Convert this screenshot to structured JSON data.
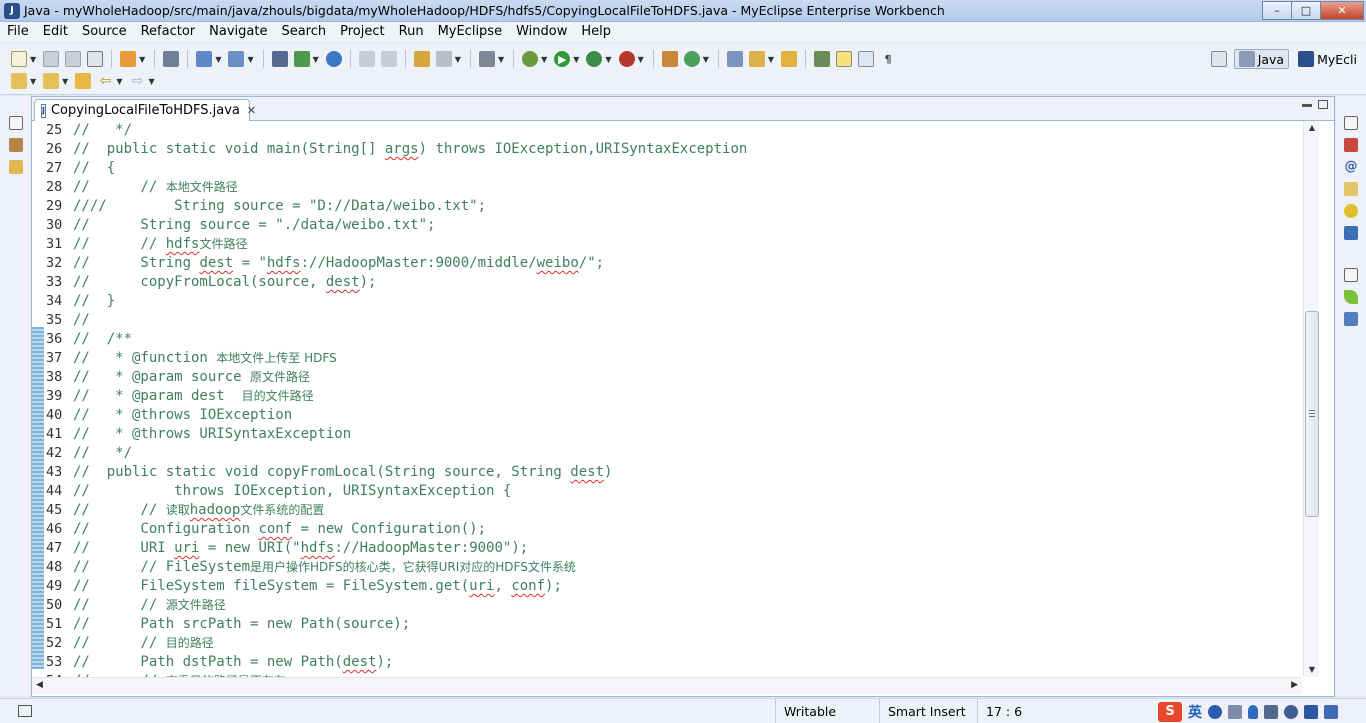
{
  "window": {
    "title": "Java - myWholeHadoop/src/main/java/zhouls/bigdata/myWholeHadoop/HDFS/hdfs5/CopyingLocalFileToHDFS.java - MyEclipse Enterprise Workbench",
    "app_icon": "J",
    "buttons": {
      "minimize": "–",
      "maximize": "□",
      "close": "✕"
    }
  },
  "menu": [
    "File",
    "Edit",
    "Source",
    "Refactor",
    "Navigate",
    "Search",
    "Project",
    "Run",
    "MyEclipse",
    "Window",
    "Help"
  ],
  "perspectives": {
    "java": "Java",
    "myeclipse": "MyEcli"
  },
  "editor": {
    "tab_label": "CopyingLocalFileToHDFS.java",
    "tab_icon": "J",
    "tab_close": "✕",
    "lines": [
      {
        "n": "25",
        "segs": [
          {
            "t": "//   */"
          }
        ]
      },
      {
        "n": "26",
        "segs": [
          {
            "t": "//  public static void main(String[] "
          },
          {
            "t": "args",
            "sq": true
          },
          {
            "t": ") throws IOException,URISyntaxException"
          }
        ]
      },
      {
        "n": "27",
        "segs": [
          {
            "t": "//  {"
          }
        ]
      },
      {
        "n": "28",
        "segs": [
          {
            "t": "//      // "
          },
          {
            "t": "本地文件路径",
            "cjk": true
          }
        ]
      },
      {
        "n": "29",
        "segs": [
          {
            "t": "////        String source = \"D://Data/weibo.txt\";"
          }
        ]
      },
      {
        "n": "30",
        "segs": [
          {
            "t": "//      String source = \"./data/weibo.txt\";"
          }
        ]
      },
      {
        "n": "31",
        "segs": [
          {
            "t": "//      // "
          },
          {
            "t": "hdfs",
            "sq": true
          },
          {
            "t": "文件路径",
            "cjk": true
          }
        ]
      },
      {
        "n": "32",
        "segs": [
          {
            "t": "//      String "
          },
          {
            "t": "dest",
            "sq": true
          },
          {
            "t": " = \""
          },
          {
            "t": "hdfs",
            "sq": true
          },
          {
            "t": "://HadoopMaster:9000/middle/"
          },
          {
            "t": "weibo",
            "sq": true
          },
          {
            "t": "/\";"
          }
        ]
      },
      {
        "n": "33",
        "segs": [
          {
            "t": "//      copyFromLocal(source, "
          },
          {
            "t": "dest",
            "sq": true
          },
          {
            "t": ");"
          }
        ]
      },
      {
        "n": "34",
        "segs": [
          {
            "t": "//  }"
          }
        ]
      },
      {
        "n": "35",
        "segs": [
          {
            "t": "//"
          }
        ]
      },
      {
        "n": "36",
        "segs": [
          {
            "t": "//  /**"
          }
        ]
      },
      {
        "n": "37",
        "segs": [
          {
            "t": "//   * @function "
          },
          {
            "t": "本地文件上传至 HDFS",
            "cjk": true
          }
        ]
      },
      {
        "n": "38",
        "segs": [
          {
            "t": "//   * @param source "
          },
          {
            "t": "原文件路径",
            "cjk": true
          }
        ]
      },
      {
        "n": "39",
        "segs": [
          {
            "t": "//   * @param dest  "
          },
          {
            "t": "目的文件路径",
            "cjk": true
          }
        ]
      },
      {
        "n": "40",
        "segs": [
          {
            "t": "//   * @throws IOException"
          }
        ]
      },
      {
        "n": "41",
        "segs": [
          {
            "t": "//   * @throws URISyntaxException"
          }
        ]
      },
      {
        "n": "42",
        "segs": [
          {
            "t": "//   */"
          }
        ]
      },
      {
        "n": "43",
        "segs": [
          {
            "t": "//  public static void copyFromLocal(String source, String "
          },
          {
            "t": "dest",
            "sq": true
          },
          {
            "t": ")"
          }
        ]
      },
      {
        "n": "44",
        "segs": [
          {
            "t": "//          throws IOException, URISyntaxException {"
          }
        ]
      },
      {
        "n": "45",
        "segs": [
          {
            "t": "//      // "
          },
          {
            "t": "读取",
            "cjk": true
          },
          {
            "t": "hadoop",
            "sq": true
          },
          {
            "t": "文件系统的配置",
            "cjk": true
          }
        ]
      },
      {
        "n": "46",
        "segs": [
          {
            "t": "//      Configuration "
          },
          {
            "t": "conf",
            "sq": true
          },
          {
            "t": " = new Configuration();"
          }
        ]
      },
      {
        "n": "47",
        "segs": [
          {
            "t": "//      URI "
          },
          {
            "t": "uri",
            "sq": true
          },
          {
            "t": " = new URI(\""
          },
          {
            "t": "hdfs",
            "sq": true
          },
          {
            "t": "://HadoopMaster:9000\");"
          }
        ]
      },
      {
        "n": "48",
        "segs": [
          {
            "t": "//      // FileSystem"
          },
          {
            "t": "是用户操作HDFS的核心类，它获得URI对应的HDFS文件系统",
            "cjk": true
          }
        ]
      },
      {
        "n": "49",
        "segs": [
          {
            "t": "//      FileSystem fileSystem = FileSystem.get("
          },
          {
            "t": "uri",
            "sq": true
          },
          {
            "t": ", "
          },
          {
            "t": "conf",
            "sq": true
          },
          {
            "t": ");"
          }
        ]
      },
      {
        "n": "50",
        "segs": [
          {
            "t": "//      // "
          },
          {
            "t": "源文件路径",
            "cjk": true
          }
        ]
      },
      {
        "n": "51",
        "segs": [
          {
            "t": "//      Path srcPath = new Path(source);"
          }
        ]
      },
      {
        "n": "52",
        "segs": [
          {
            "t": "//      // "
          },
          {
            "t": "目的路径",
            "cjk": true
          }
        ]
      },
      {
        "n": "53",
        "segs": [
          {
            "t": "//      Path dstPath = new Path("
          },
          {
            "t": "dest",
            "sq": true
          },
          {
            "t": ");"
          }
        ]
      },
      {
        "n": "54",
        "segs": [
          {
            "t": "//      // "
          },
          {
            "t": "查看目的路径是否存在",
            "cjk": true
          }
        ]
      }
    ]
  },
  "status": {
    "writable": "Writable",
    "insert_mode": "Smart Insert",
    "position": "17 : 6",
    "ime_logo": "S",
    "ime_lang": "英"
  },
  "colors": {
    "comment": "#3f7f5f",
    "error_squiggle": "#e0302a",
    "accent": "#2b4e8c"
  }
}
